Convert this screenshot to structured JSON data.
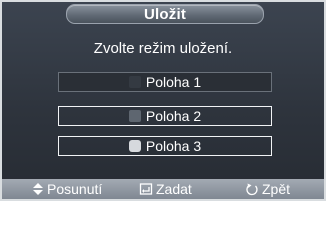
{
  "dialog": {
    "title": "Uložit",
    "prompt": "Zvolte režim uložení."
  },
  "options": [
    {
      "label": "Poloha 1",
      "state": "empty"
    },
    {
      "label": "Poloha 2",
      "state": "filled"
    },
    {
      "label": "Poloha 3",
      "state": "selected"
    }
  ],
  "nav": {
    "move": {
      "icon": "up-down-arrows-icon",
      "label": "Posunutí"
    },
    "enter": {
      "icon": "enter-icon",
      "label": "Zadat"
    },
    "back": {
      "icon": "return-icon",
      "label": "Zpět"
    }
  },
  "colors": {
    "panel_dark": "#2e343d",
    "title_tab": "#5f6873",
    "nav_bar": "#8a929c",
    "highlight_border": "#f1f3f5",
    "text": "#ffffff"
  }
}
